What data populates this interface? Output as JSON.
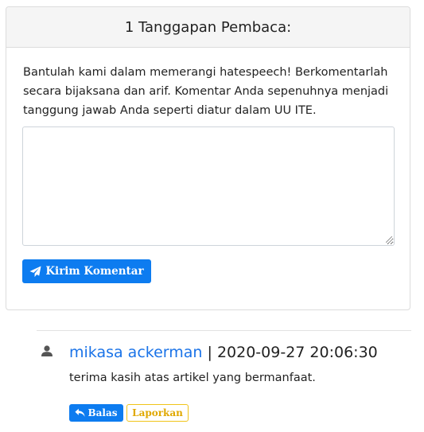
{
  "comments_section": {
    "header_title": "1 Tanggapan Pembaca:",
    "intro_text": "Bantulah kami dalam memerangi hatespeech! Berkomentarlah secara bijaksana dan arif. Komentar Anda sepenuhnya menjadi tanggung jawab Anda seperti diatur dalam UU ITE.",
    "comment_input_value": "",
    "submit_label": "Kirim Komentar",
    "submit_icon": "paper-plane-icon"
  },
  "comments": [
    {
      "author": "mikasa ackerman",
      "separator": " | ",
      "timestamp": "2020-09-27 20:06:30",
      "text": "terima kasih atas artikel yang bermanfaat.",
      "reply_label": "Balas",
      "reply_icon": "reply-icon",
      "report_label": "Laporkan",
      "avatar_icon": "user-icon"
    }
  ],
  "colors": {
    "primary": "#0d7cf0",
    "link": "#1a73e8",
    "warning": "#f0c419"
  }
}
